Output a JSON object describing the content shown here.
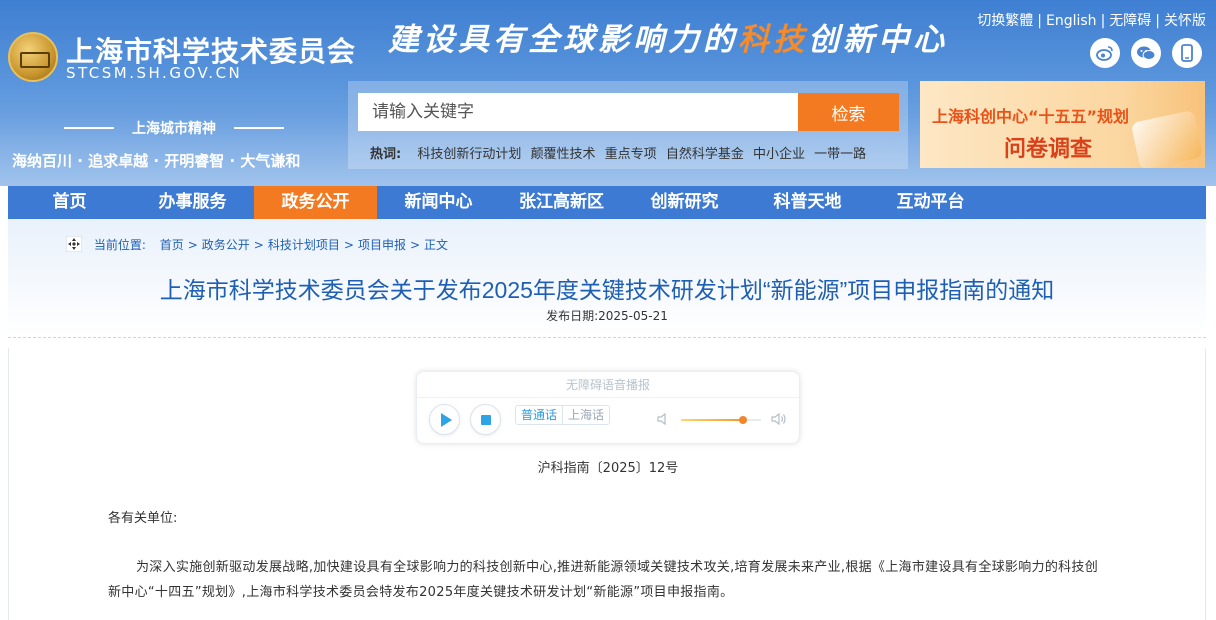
{
  "header": {
    "site_title": "上海市科学技术委员会",
    "site_domain": "STCSM.SH.GOV.CN",
    "slogan_part1": "建设具有全球影响力的",
    "slogan_highlight": "科技",
    "slogan_part2": "创新中心",
    "top_links": [
      "切换繁體",
      "English",
      "无障碍",
      "关怀版"
    ],
    "social": {
      "weibo_label": "微",
      "wechat_label": "信",
      "mobile_label": "▯"
    },
    "spirit_title": "上海城市精神",
    "spirit_text": "海纳百川 · 追求卓越 · 开明睿智 · 大气谦和",
    "accent_color": "#f47a21",
    "primary_color": "#3c7ad3"
  },
  "search": {
    "placeholder": "请输入关键字",
    "button_label": "检索",
    "hot_label": "热词:",
    "hot_words": [
      "科技创新行动计划",
      "颠覆性技术",
      "重点专项",
      "自然科学基金",
      "中小企业",
      "一带一路"
    ]
  },
  "banner": {
    "line1": "上海科创中心“十五五”规划",
    "line2": "问卷调查"
  },
  "nav": {
    "items": [
      "首页",
      "办事服务",
      "政务公开",
      "新闻中心",
      "张江高新区",
      "创新研究",
      "科普天地",
      "互动平台"
    ],
    "active_index": 2
  },
  "breadcrumb": {
    "label": "当前位置:",
    "items": [
      "首页",
      "政务公开",
      "科技计划项目",
      "项目申报",
      "正文"
    ]
  },
  "article": {
    "title": "上海市科学技术委员会关于发布2025年度关键技术研发计划“新能源”项目申报指南的通知",
    "publish_date": "发布日期:2025-05-21",
    "doc_number": "沪科指南〔2025〕12号",
    "salutation": "各有关单位:",
    "paragraph_1": "为深入实施创新驱动发展战略,加快建设具有全球影响力的科技创新中心,推进新能源领域关键技术攻关,培育发展未来产业,根据《上海市建设具有全球影响力的科技创新中心“十四五”规划》,上海市科学技术委员会特发布2025年度关键技术研发计划“新能源”项目申报指南。"
  },
  "audio": {
    "title": "无障碍语音播报",
    "dialect_mandarin": "普通话",
    "dialect_shanghai": "上海话",
    "volume_level": 0.78
  }
}
